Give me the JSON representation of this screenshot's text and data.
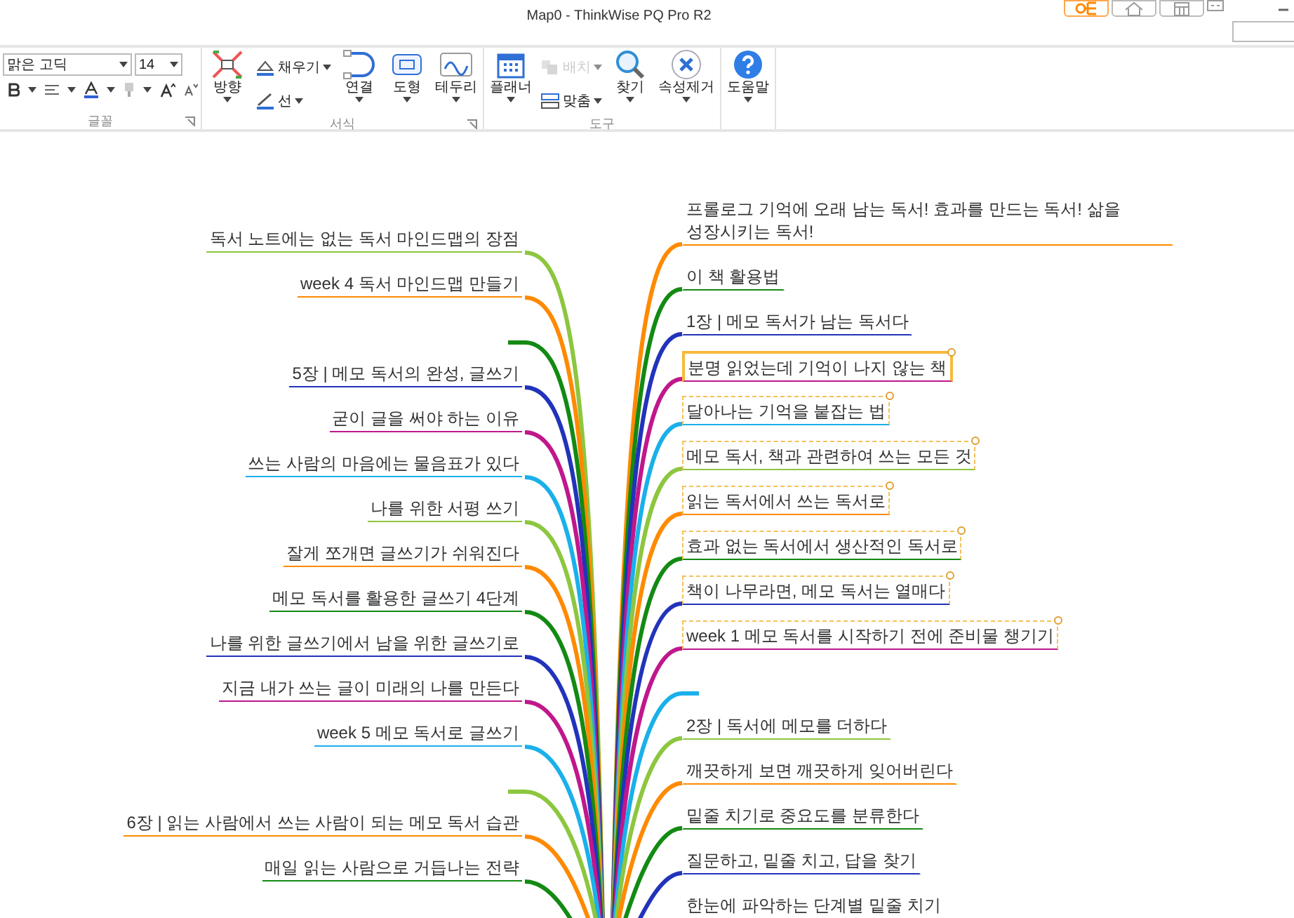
{
  "window": {
    "title": "Map0 - ThinkWise PQ Pro R2"
  },
  "view_tabs": [
    {
      "selected": true
    },
    {
      "selected": false
    },
    {
      "selected": false
    }
  ],
  "ribbon": {
    "groups": [
      {
        "kind": "font",
        "label": "글꼴",
        "font_name": "맑은 고딕",
        "font_size": "14"
      },
      {
        "kind": "buttons",
        "label": "서식",
        "items": [
          {
            "kind": "large",
            "label": "방향",
            "disabled": false
          },
          {
            "kind": "small",
            "label": "채우기",
            "disabled": false
          },
          {
            "kind": "small",
            "label": "선",
            "disabled": false
          },
          {
            "kind": "large",
            "label": "연결",
            "disabled": false
          },
          {
            "kind": "large",
            "label": "도형",
            "disabled": false
          },
          {
            "kind": "large",
            "label": "테두리",
            "disabled": false
          }
        ]
      },
      {
        "kind": "buttons",
        "label": "도구",
        "items": [
          {
            "kind": "large",
            "label": "플래너",
            "disabled": false
          },
          {
            "kind": "small",
            "label": "배치",
            "disabled": true
          },
          {
            "kind": "small",
            "label": "맞춤",
            "disabled": false
          },
          {
            "kind": "large",
            "label": "찾기",
            "disabled": false
          },
          {
            "kind": "large",
            "label": "속성제거",
            "disabled": false
          }
        ]
      },
      {
        "kind": "buttons",
        "items": [
          {
            "kind": "large",
            "label": "도움말",
            "disabled": false
          }
        ]
      }
    ]
  },
  "map": {
    "left_branches": [
      {
        "text": "독서 노트에는 없는 독서 마인드맵의 장점",
        "color": "#8dc63f"
      },
      {
        "text": "week 4 독서 마인드맵 만들기",
        "color": "#ff8a00"
      },
      {
        "color": "#138a13"
      },
      {
        "text": "5장 | 메모 독서의 완성, 글쓰기",
        "color": "#2233bb"
      },
      {
        "text": "굳이 글을 써야 하는 이유",
        "color": "#c0178c"
      },
      {
        "text": "쓰는 사람의 마음에는 물음표가 있다",
        "color": "#1ab0ea"
      },
      {
        "text": "나를 위한 서평 쓰기",
        "color": "#8dc63f"
      },
      {
        "text": "잘게 쪼개면 글쓰기가 쉬워진다",
        "color": "#ff8a00"
      },
      {
        "text": "메모 독서를 활용한 글쓰기 4단계",
        "color": "#138a13"
      },
      {
        "text": "나를 위한 글쓰기에서 남을 위한 글쓰기로",
        "color": "#2233bb"
      },
      {
        "text": "지금 내가 쓰는 글이 미래의 나를 만든다",
        "color": "#c0178c"
      },
      {
        "text": "week 5 메모 독서로 글쓰기",
        "color": "#1ab0ea"
      },
      {
        "color": "#8dc63f"
      },
      {
        "text": "6장 | 읽는 사람에서 쓰는 사람이 되는 메모 독서 습관",
        "color": "#ff8a00"
      },
      {
        "text": "매일 읽는 사람으로 거듭나는 전략",
        "color": "#138a13"
      }
    ],
    "right_branches": [
      {
        "text": "프롤로그 기억에 오래 남는 독서! 효과를 만드는 독서! 삶을 성장시키는 독서!",
        "color": "#ff8a00",
        "selected": false,
        "focused": false
      },
      {
        "text": "이 책 활용법",
        "color": "#138a13",
        "selected": false,
        "focused": false
      },
      {
        "text": "1장 | 메모 독서가 남는 독서다",
        "color": "#2233bb",
        "selected": false,
        "focused": false
      },
      {
        "text": "분명 읽었는데 기억이 나지 않는 책",
        "color": "#c0178c",
        "selected": true,
        "focused": true
      },
      {
        "text": "달아나는 기억을 붙잡는 법",
        "color": "#1ab0ea",
        "selected": true,
        "focused": false
      },
      {
        "text": "메모 독서, 책과 관련하여 쓰는 모든 것",
        "color": "#8dc63f",
        "selected": true,
        "focused": false
      },
      {
        "text": "읽는 독서에서 쓰는 독서로",
        "color": "#ff8a00",
        "selected": true,
        "focused": false
      },
      {
        "text": "효과 없는 독서에서 생산적인 독서로",
        "color": "#138a13",
        "selected": true,
        "focused": false
      },
      {
        "text": "책이 나무라면, 메모 독서는 열매다",
        "color": "#2233bb",
        "selected": true,
        "focused": false
      },
      {
        "text": "week 1 메모 독서를 시작하기 전에 준비물 챙기기",
        "color": "#c0178c",
        "selected": true,
        "focused": false
      },
      {
        "color": "#1ab0ea"
      },
      {
        "text": "2장 | 독서에 메모를 더하다",
        "color": "#8dc63f",
        "selected": false,
        "focused": false
      },
      {
        "text": "깨끗하게 보면 깨끗하게 잊어버린다",
        "color": "#ff8a00",
        "selected": false,
        "focused": false
      },
      {
        "text": "밑줄 치기로 중요도를 분류한다",
        "color": "#138a13",
        "selected": false,
        "focused": false
      },
      {
        "text": "질문하고, 밑줄 치고, 답을 찾기",
        "color": "#2233bb",
        "selected": false,
        "focused": false
      },
      {
        "text": "한눈에 파악하는 단계별 밑줄 치기",
        "selected": false,
        "focused": false
      }
    ]
  }
}
